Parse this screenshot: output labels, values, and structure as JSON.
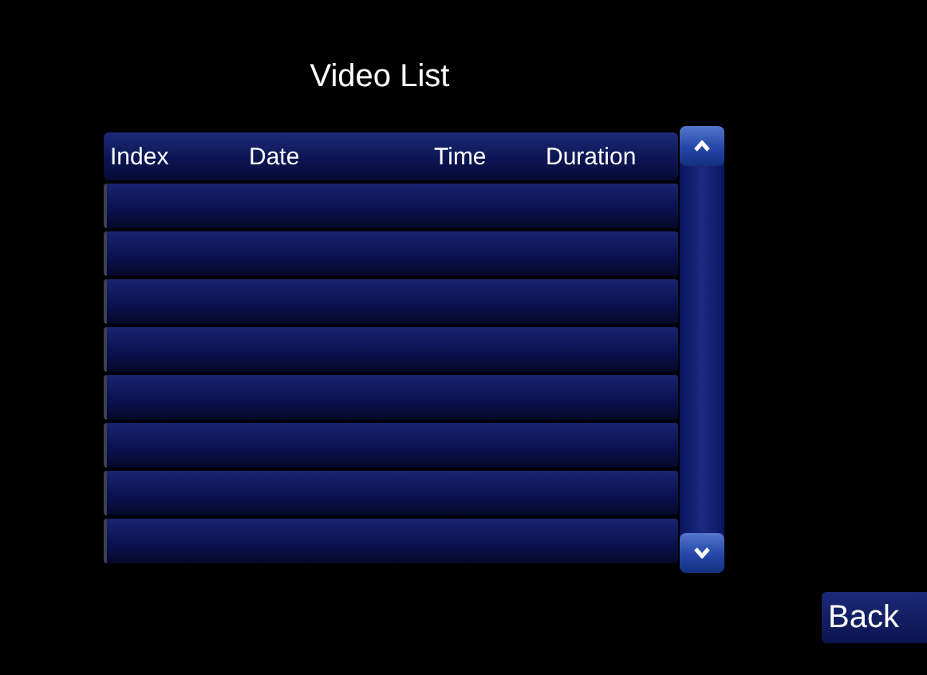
{
  "title": "Video List",
  "table": {
    "columns": [
      "Index",
      "Date",
      "Time",
      "Duration"
    ],
    "rows": [
      {
        "kind": "empty"
      },
      {
        "kind": "empty"
      },
      {
        "kind": "empty"
      },
      {
        "kind": "empty"
      },
      {
        "kind": "empty"
      },
      {
        "kind": "empty"
      },
      {
        "kind": "empty"
      },
      {
        "kind": "empty"
      }
    ]
  },
  "back_button": "Back"
}
